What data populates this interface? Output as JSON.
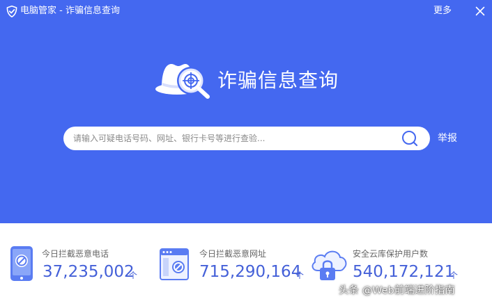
{
  "window": {
    "title": "电脑管家 - 诈骗信息查询",
    "more_label": "更多",
    "close_icon": "close-icon",
    "app_icon": "shield-check-icon"
  },
  "hero": {
    "title": "诈骗信息查询",
    "icon": "spy-hat-magnifier-icon"
  },
  "search": {
    "placeholder": "请输入可疑电话号码、网址、银行卡号等进行查验...",
    "value": "",
    "icon": "search-icon",
    "report_label": "举报"
  },
  "stats": [
    {
      "label": "今日拦截恶意电话",
      "value": "37,235,002",
      "unit": "个",
      "icon": "blocked-phone-icon"
    },
    {
      "label": "今日拦截恶意网址",
      "value": "715,290,164",
      "unit": "个",
      "icon": "blocked-webpage-icon"
    },
    {
      "label": "安全云库保护用户数",
      "value": "540,172,121",
      "unit": "个",
      "icon": "cloud-lock-icon"
    }
  ],
  "watermark": "头条 @Web前端进阶指南",
  "colors": {
    "hero_background": "#4468f0",
    "stat_value": "#4460d8",
    "stat_label": "#666666",
    "placeholder": "#8a8a8a"
  }
}
